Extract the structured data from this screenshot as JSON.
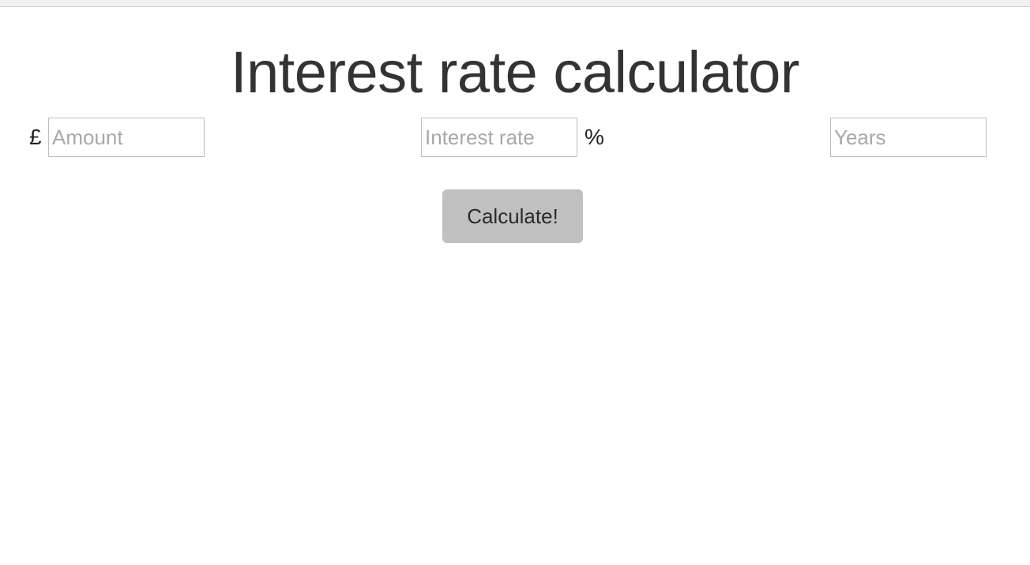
{
  "page": {
    "title": "Interest rate calculator"
  },
  "form": {
    "currency_symbol": "£",
    "amount_placeholder": "Amount",
    "rate_placeholder": "Interest rate",
    "percent_symbol": "%",
    "years_placeholder": "Years",
    "calculate_label": "Calculate!"
  },
  "colors": {
    "text": "#333333",
    "placeholder": "#a8a8a8",
    "button_bg": "#c0c0c0",
    "input_border": "#bdbdbd"
  }
}
